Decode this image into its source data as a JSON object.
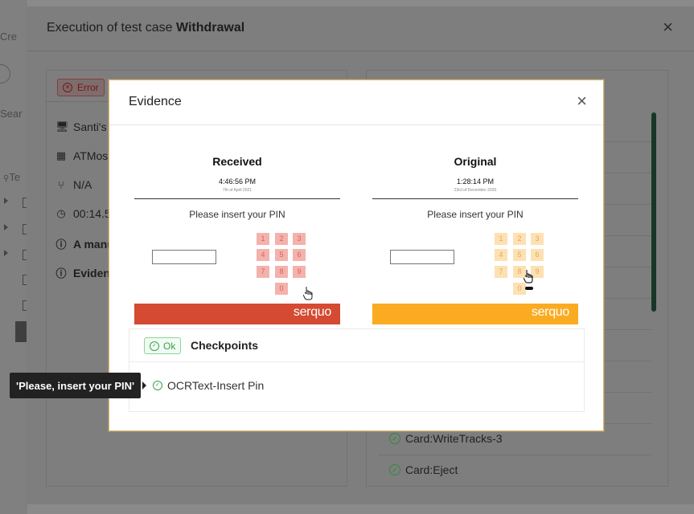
{
  "background": {
    "fragments": [
      "Cre",
      "Sear",
      "Te"
    ]
  },
  "exec_dialog": {
    "title_prefix": "Execution of test case ",
    "title_case": "Withdrawal",
    "close_glyph": "×",
    "status_badge": "Error",
    "info": [
      {
        "icon": "monitor-icon",
        "glyph": "🖥",
        "text": "Santi's"
      },
      {
        "icon": "grid-icon",
        "glyph": "▦",
        "text": "ATMos"
      },
      {
        "icon": "branch-icon",
        "glyph": "⑂",
        "text": "N/A"
      },
      {
        "icon": "clock-icon",
        "glyph": "◷",
        "text": "00:14.5"
      },
      {
        "icon": "info-icon",
        "glyph": "ⓘ",
        "text": "A manu"
      },
      {
        "icon": "info-icon",
        "glyph": "ⓘ",
        "text": "Eviden"
      }
    ],
    "checks": [
      "Card:WriteTracks-3",
      "Card:Eject"
    ]
  },
  "tooltip": "'Please, insert your PIN'",
  "evidence": {
    "title": "Evidence",
    "close_glyph": "×",
    "received": {
      "title": "Received",
      "time": "4:46:56 PM",
      "date": "7th of April 2021",
      "prompt": "Please insert your PIN",
      "keys": [
        "1",
        "2",
        "3",
        "4",
        "5",
        "6",
        "7",
        "8",
        "9",
        "0"
      ],
      "logo": "serquo",
      "bar_color": "#d44a32"
    },
    "original": {
      "title": "Original",
      "time": "1:28:14 PM",
      "date": "23rd of December 2020",
      "prompt": "Please insert your PIN",
      "keys": [
        "1",
        "2",
        "3",
        "4",
        "5",
        "6",
        "7",
        "8",
        "9",
        "0"
      ],
      "logo": "serquo",
      "bar_color": "#fbab22"
    },
    "checkpoints": {
      "status": "Ok",
      "title": "Checkpoints",
      "items": [
        "OCRText-Insert Pin"
      ]
    }
  }
}
